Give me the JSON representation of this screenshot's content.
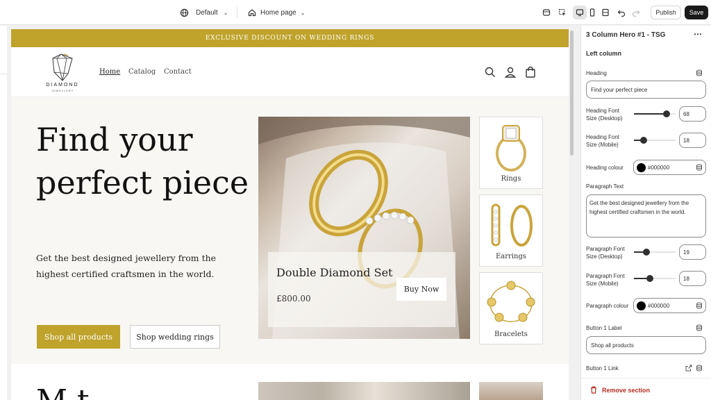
{
  "topbar": {
    "theme_label": "Default",
    "page_label": "Home page",
    "publish_label": "Publish",
    "save_label": "Save"
  },
  "store": {
    "announcement": "EXCLUSIVE DISCOUNT ON WEDDING RINGS",
    "logo_name": "DIAMOND",
    "logo_tagline": "JEWELLERY",
    "nav": [
      "Home",
      "Catalog",
      "Contact"
    ],
    "hero": {
      "heading_line1": "Find your",
      "heading_line2": "perfect piece",
      "paragraph": "Get the best designed jewellery from the highest certified craftsmen in the world.",
      "button1": "Shop all products",
      "button2": "Shop wedding rings",
      "feature_title": "Double Diamond Set",
      "feature_price": "£800.00",
      "feature_button": "Buy Now",
      "thumbs": [
        "Rings",
        "Earrings",
        "Bracelets"
      ]
    },
    "next_heading_fragment": "M       t"
  },
  "panel": {
    "title": "3 Column Hero #1 - TSG",
    "section_label": "Left column",
    "heading_label": "Heading",
    "heading_value": "Find your perfect piece",
    "hfd_label_1": "Heading Font",
    "hfd_label_2": "Size (Desktop)",
    "hfd_value": "68",
    "hfm_label_1": "Heading Font",
    "hfm_label_2": "Size (Mobile)",
    "hfm_value": "18",
    "heading_colour_label": "Heading colour",
    "heading_colour_value": "#000000",
    "para_label": "Paragraph Text",
    "para_value": "Get the best designed jewellery from the highest certified craftsmen in the world.",
    "pfd_label_1": "Paragraph Font",
    "pfd_label_2": "Size (Desktop)",
    "pfd_value": "19",
    "pfm_label_1": "Paragraph Font",
    "pfm_label_2": "Size (Mobile)",
    "pfm_value": "18",
    "para_colour_label": "Paragraph colour",
    "para_colour_value": "#000000",
    "btn1_label_label": "Button 1 Label",
    "btn1_label_value": "Shop all products",
    "btn1_link_label": "Button 1 Link",
    "remove_label": "Remove section",
    "sliders": {
      "hfd": 0.78,
      "hfm": 0.24,
      "pfd": 0.3,
      "pfm": 0.38
    }
  },
  "colors": {
    "accent": "#bfa32b",
    "danger": "#b62d1f"
  }
}
